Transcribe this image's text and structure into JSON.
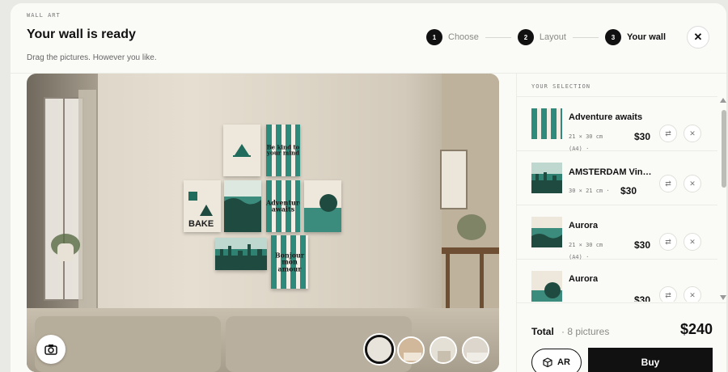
{
  "header": {
    "eyebrow": "WALL ART",
    "title": "Your wall is ready",
    "subtitle": "Drag the pictures. However you like."
  },
  "steps": [
    {
      "num": "1",
      "label": "Choose"
    },
    {
      "num": "2",
      "label": "Layout"
    },
    {
      "num": "3",
      "label": "Your wall"
    }
  ],
  "close_label": "✕",
  "canvas": {
    "prints": {
      "be_kind": "Be kind to your mind",
      "adventure": "Adventure awaits",
      "bake": "BAKE",
      "bonjour": "Bonjour mon amour"
    }
  },
  "panel": {
    "label": "YOUR SELECTION",
    "items": [
      {
        "name": "Adventure awaits",
        "size": "21 × 30 cm",
        "size2": "(A4) ·",
        "price": "$30"
      },
      {
        "name": "AMSTERDAM Vint…",
        "size": "30 × 21 cm ·",
        "size2": "",
        "price": "$30"
      },
      {
        "name": "Aurora",
        "size": "21 × 30 cm",
        "size2": "(A4) ·",
        "price": "$30"
      },
      {
        "name": "Aurora",
        "size": "",
        "size2": "",
        "price": "$30"
      }
    ],
    "total_label": "Total",
    "total_count": "· 8 pictures",
    "total_price": "$240",
    "ar_label": "AR",
    "buy_label": "Buy"
  },
  "colors": {
    "accent": "#2e8a7a",
    "dark_green": "#1f4a40",
    "cream": "#efe9dd",
    "button_dark": "#111111"
  },
  "icons": [
    "camera-icon",
    "ar-cube-icon",
    "swap-icon",
    "remove-icon",
    "close-icon",
    "scroll-up-icon",
    "scroll-down-icon"
  ]
}
